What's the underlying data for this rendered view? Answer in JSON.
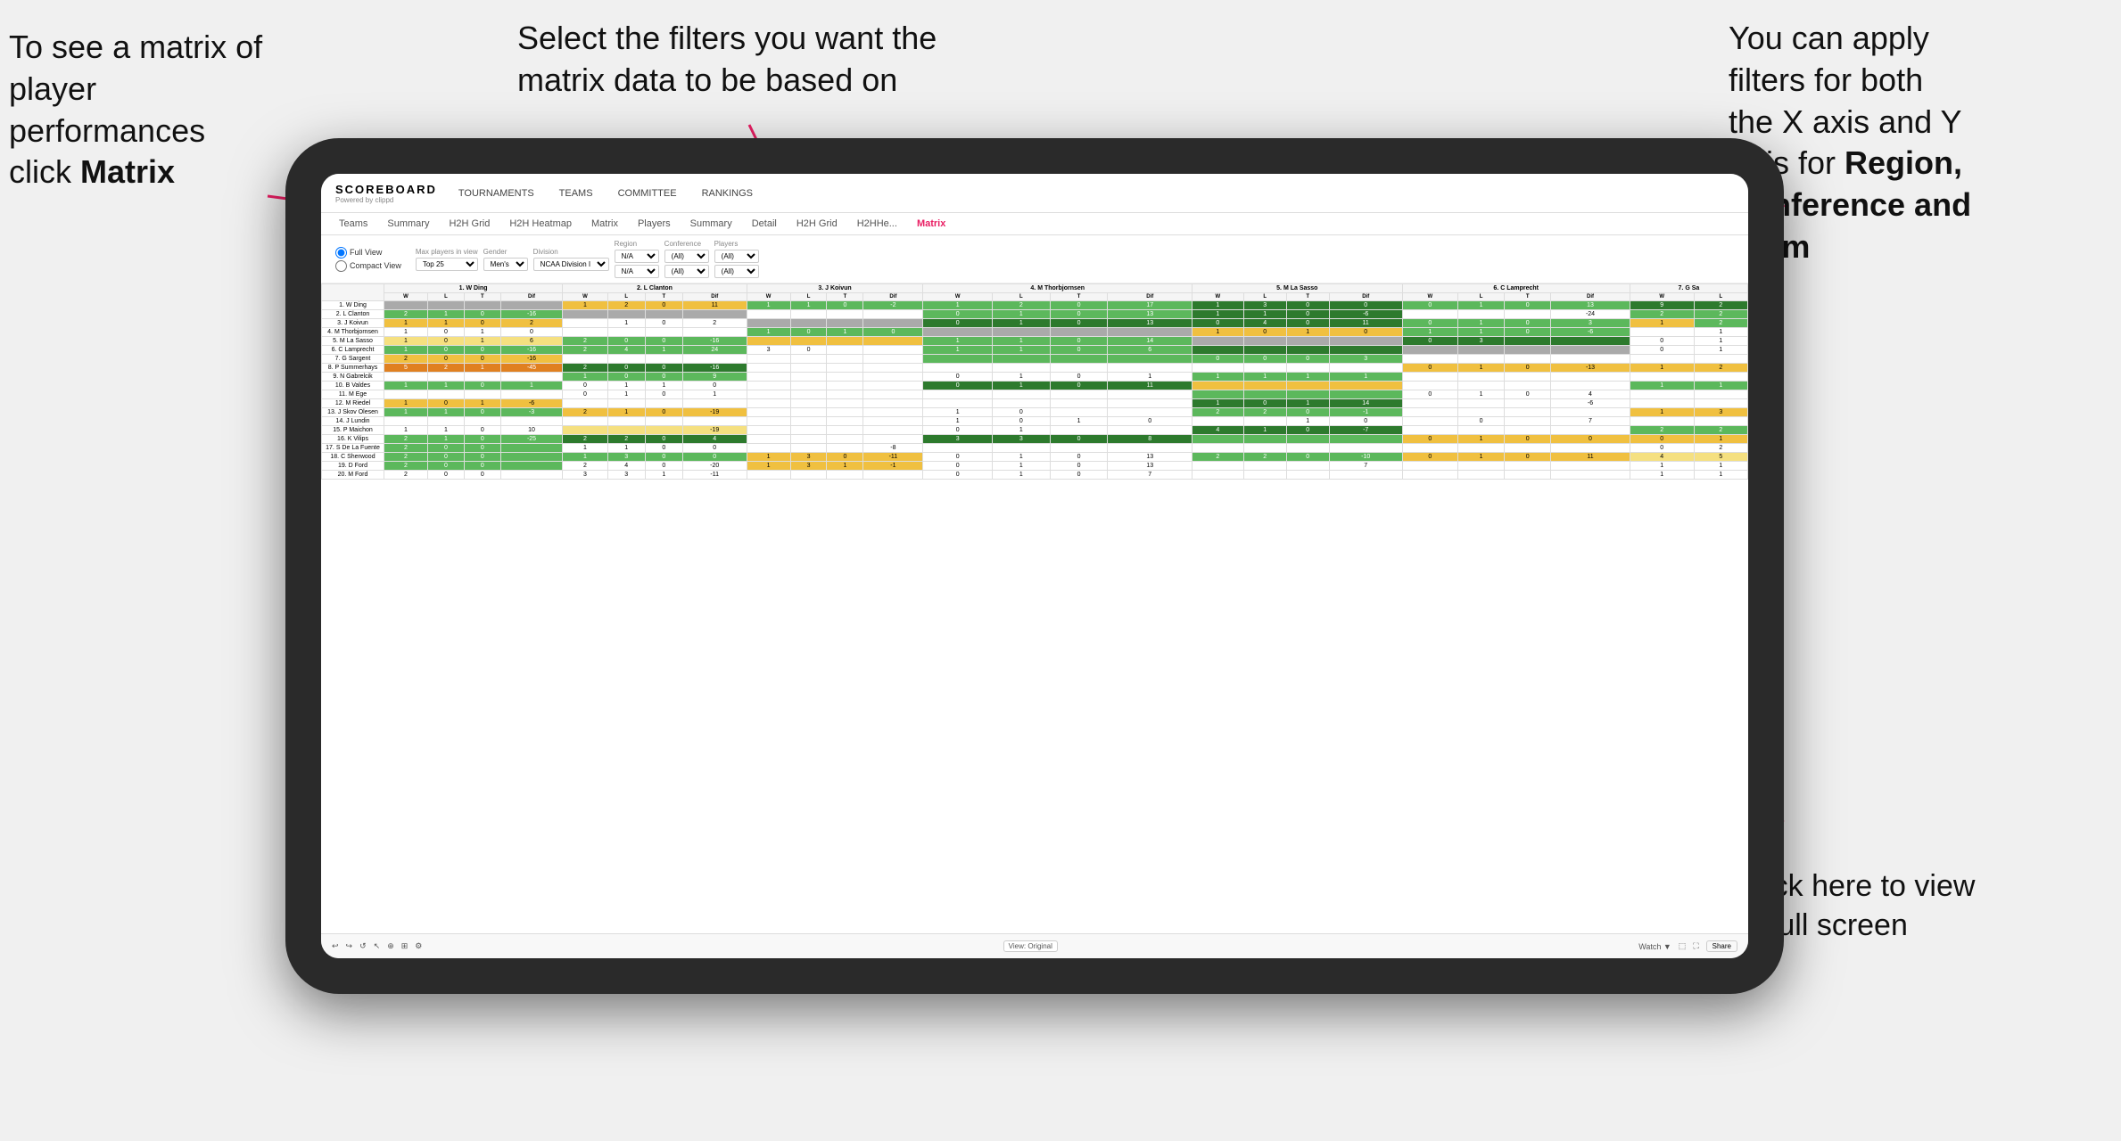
{
  "annotations": {
    "top_left": {
      "line1": "To see a matrix of",
      "line2": "player performances",
      "line3_normal": "click ",
      "line3_bold": "Matrix"
    },
    "top_center": {
      "text": "Select the filters you want the matrix data to be based on"
    },
    "top_right": {
      "line1": "You  can apply",
      "line2": "filters for both",
      "line3": "the X axis and Y",
      "line4_normal": "Axis for ",
      "line4_bold": "Region,",
      "line5_bold": "Conference and",
      "line6_bold": "Team"
    },
    "bottom_right": {
      "line1": "Click here to view",
      "line2": "in full screen"
    }
  },
  "app": {
    "logo": "SCOREBOARD",
    "logo_sub": "Powered by clippd",
    "nav": [
      "TOURNAMENTS",
      "TEAMS",
      "COMMITTEE",
      "RANKINGS"
    ],
    "sub_nav": [
      "Teams",
      "Summary",
      "H2H Grid",
      "H2H Heatmap",
      "Matrix",
      "Players",
      "Summary",
      "Detail",
      "H2H Grid",
      "H2HHe...",
      "Matrix"
    ],
    "active_tab": "Matrix"
  },
  "filters": {
    "view_options": [
      "Full View",
      "Compact View"
    ],
    "max_players_label": "Max players in view",
    "max_players_value": "Top 25",
    "gender_label": "Gender",
    "gender_value": "Men's",
    "division_label": "Division",
    "division_value": "NCAA Division I",
    "region_label": "Region",
    "region_values": [
      "N/A",
      "N/A"
    ],
    "conference_label": "Conference",
    "conference_values": [
      "(All)",
      "(All)"
    ],
    "players_label": "Players",
    "players_values": [
      "(All)",
      "(All)"
    ]
  },
  "matrix": {
    "col_groups": [
      {
        "name": "1. W Ding",
        "cols": [
          "W",
          "L",
          "T",
          "Dif"
        ]
      },
      {
        "name": "2. L Clanton",
        "cols": [
          "W",
          "L",
          "T",
          "Dif"
        ]
      },
      {
        "name": "3. J Koivun",
        "cols": [
          "W",
          "L",
          "T",
          "Dif"
        ]
      },
      {
        "name": "4. M Thorbjornsen",
        "cols": [
          "W",
          "L",
          "T",
          "Dif"
        ]
      },
      {
        "name": "5. M La Sasso",
        "cols": [
          "W",
          "L",
          "T",
          "Dif"
        ]
      },
      {
        "name": "6. C Lamprecht",
        "cols": [
          "W",
          "L",
          "T",
          "Dif"
        ]
      },
      {
        "name": "7. G Sa",
        "cols": [
          "W",
          "L"
        ]
      }
    ],
    "rows": [
      {
        "name": "1. W Ding"
      },
      {
        "name": "2. L Clanton"
      },
      {
        "name": "3. J Koivun"
      },
      {
        "name": "4. M Thorbjornsen"
      },
      {
        "name": "5. M La Sasso"
      },
      {
        "name": "6. C Lamprecht"
      },
      {
        "name": "7. G Sargent"
      },
      {
        "name": "8. P Summerhays"
      },
      {
        "name": "9. N Gabrelcik"
      },
      {
        "name": "10. B Valdes"
      },
      {
        "name": "11. M Ege"
      },
      {
        "name": "12. M Riedel"
      },
      {
        "name": "13. J Skov Olesen"
      },
      {
        "name": "14. J Lundin"
      },
      {
        "name": "15. P Maichon"
      },
      {
        "name": "16. K Vilips"
      },
      {
        "name": "17. S De La Fuente"
      },
      {
        "name": "18. C Sherwood"
      },
      {
        "name": "19. D Ford"
      },
      {
        "name": "20. M Ford"
      }
    ]
  },
  "toolbar": {
    "view_label": "View: Original",
    "watch_label": "Watch ▼",
    "share_label": "Share"
  }
}
